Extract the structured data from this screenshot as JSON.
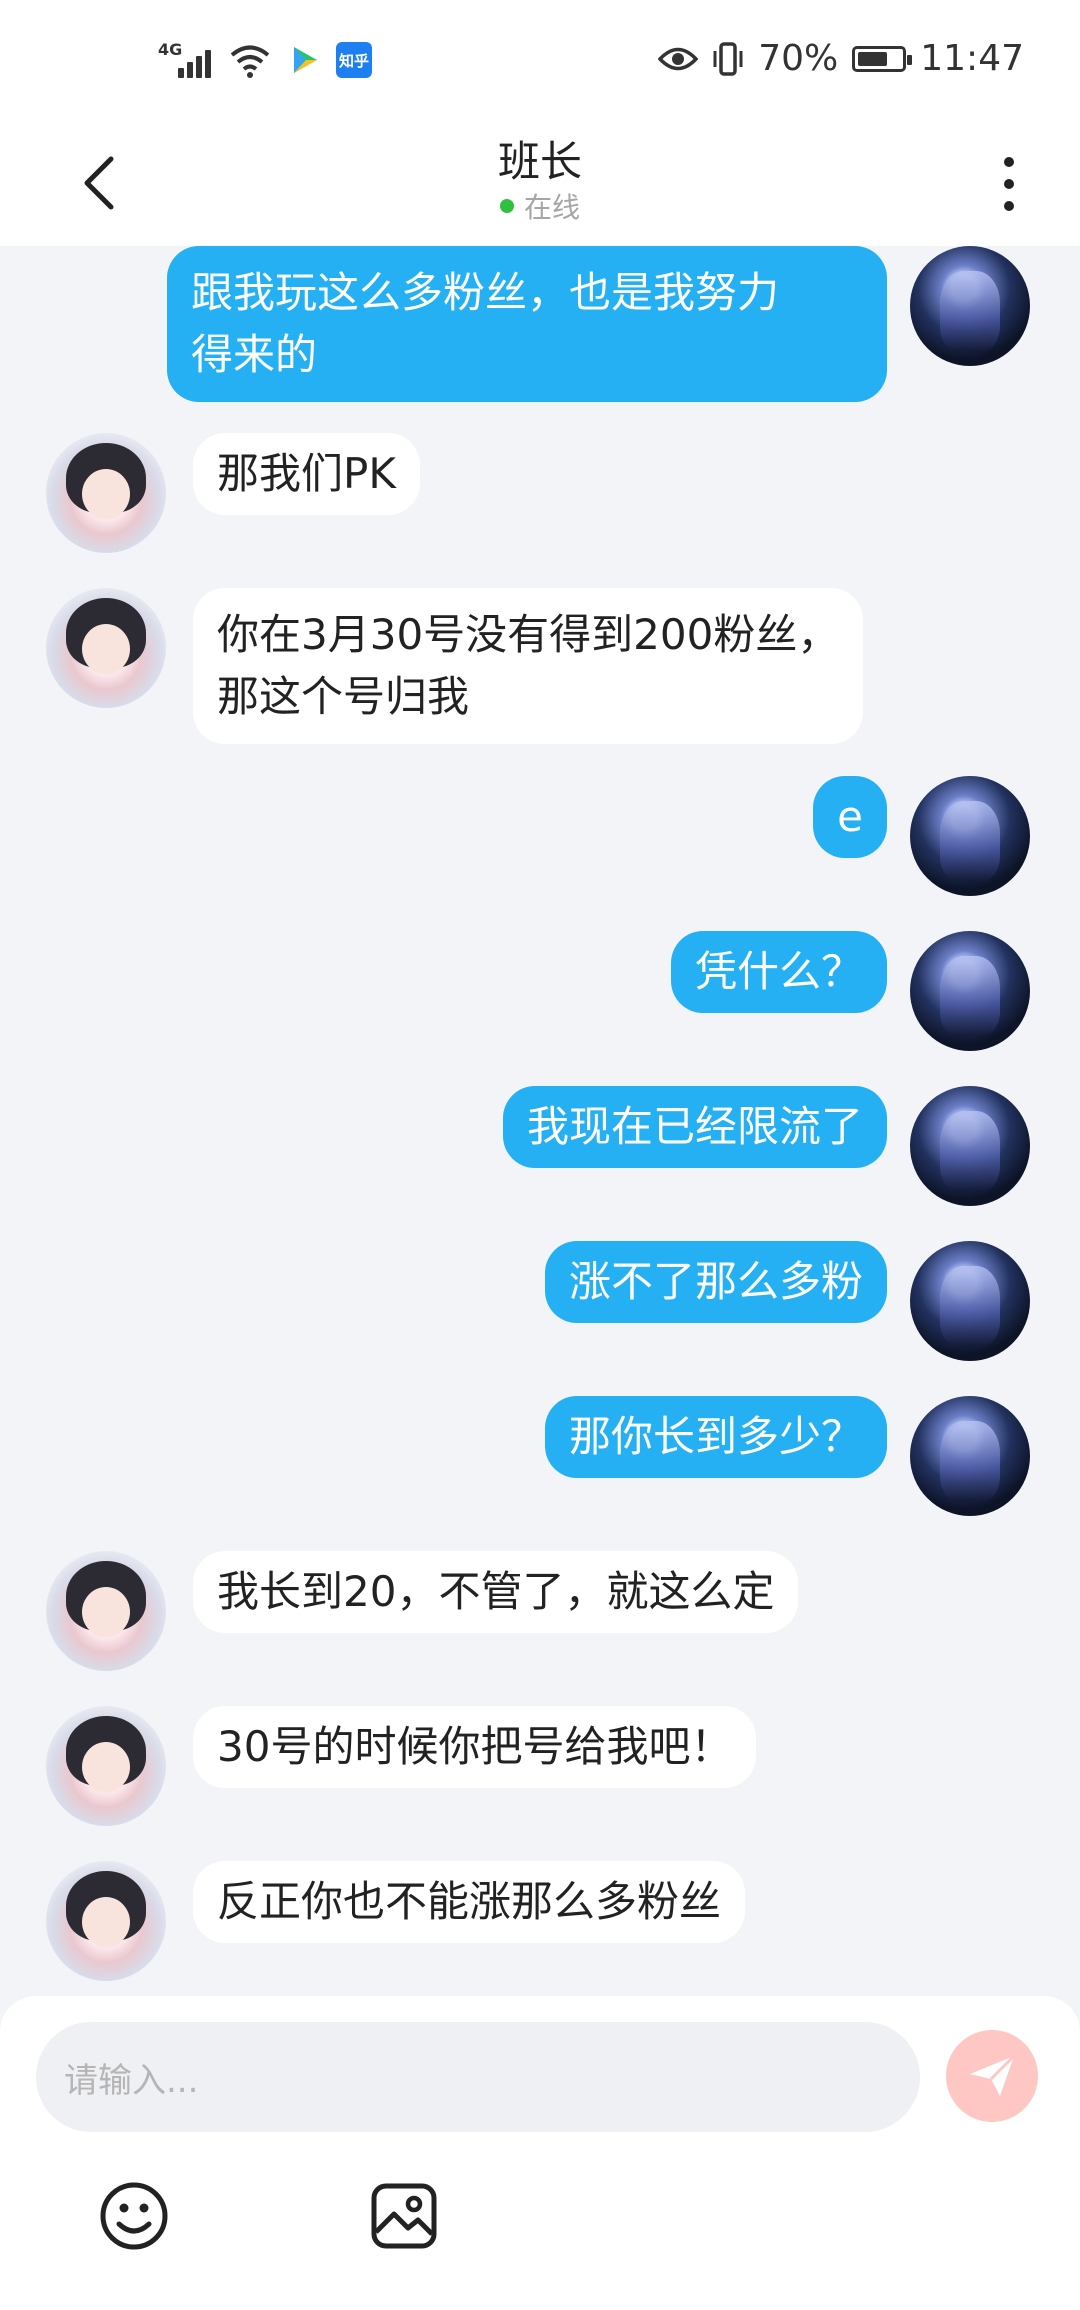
{
  "status_bar": {
    "network": "4G",
    "app_badge": "知乎",
    "battery": "70%",
    "battery_level": 0.7,
    "time": "11:47"
  },
  "header": {
    "title": "班长",
    "presence": "在线"
  },
  "messages": [
    {
      "from": "me",
      "text": "跟我玩这么多粉丝，也是我努力\n得来的"
    },
    {
      "from": "other",
      "text": "那我们PK"
    },
    {
      "from": "other",
      "text": "你在3月30号没有得到200粉丝，\n那这个号归我"
    },
    {
      "from": "me",
      "text": "e"
    },
    {
      "from": "me",
      "text": "凭什么？"
    },
    {
      "from": "me",
      "text": "我现在已经限流了"
    },
    {
      "from": "me",
      "text": "涨不了那么多粉"
    },
    {
      "from": "me",
      "text": "那你长到多少？"
    },
    {
      "from": "other",
      "text": "我长到20，不管了，就这么定"
    },
    {
      "from": "other",
      "text": "30号的时候你把号给我吧！"
    },
    {
      "from": "other",
      "text": "反正你也不能涨那么多粉丝"
    }
  ],
  "composer": {
    "placeholder": "请输入..."
  },
  "icons": {
    "back": "chevron-left-icon",
    "more": "more-vertical-icon",
    "send": "send-icon",
    "emoji": "smiley-icon",
    "image": "image-icon"
  },
  "colors": {
    "my_bubble": "#25b0f4",
    "other_bubble": "#ffffff",
    "online_dot": "#2ec13f",
    "send_button": "#ffc7c4",
    "background": "#f3f4f7"
  }
}
